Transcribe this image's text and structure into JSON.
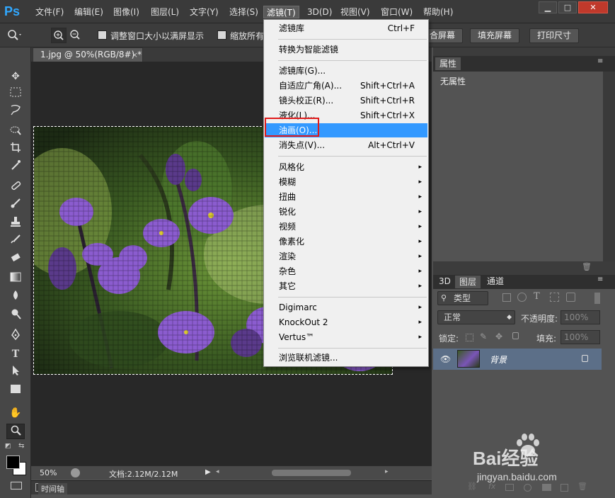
{
  "app": {
    "logo": "Ps"
  },
  "menubar": {
    "items": [
      {
        "label": "文件(F)"
      },
      {
        "label": "编辑(E)"
      },
      {
        "label": "图像(I)"
      },
      {
        "label": "图层(L)"
      },
      {
        "label": "文字(Y)"
      },
      {
        "label": "选择(S)"
      },
      {
        "label": "滤镜(T)"
      },
      {
        "label": "3D(D)"
      },
      {
        "label": "视图(V)"
      },
      {
        "label": "窗口(W)"
      },
      {
        "label": "帮助(H)"
      }
    ],
    "window_controls": {
      "minimize": "▁",
      "maximize": "□",
      "close": "✕"
    }
  },
  "optionsbar": {
    "checkbox1_label": "调整窗口大小以满屏显示",
    "checkbox2_label": "缩放所有",
    "fit_screen": "合屏幕",
    "fill_screen": "填充屏幕",
    "print_size": "打印尺寸"
  },
  "document": {
    "tab_title": "1.jpg @ 50%(RGB/8#) *",
    "tab_close": "×"
  },
  "status": {
    "zoom": "50%",
    "doc_size": "文档:2.12M/2.12M"
  },
  "timeline": {
    "label": "时间轴"
  },
  "properties_panel": {
    "tab": "属性",
    "content": "无属性"
  },
  "layers_panel": {
    "tabs": [
      "3D",
      "图层",
      "通道"
    ],
    "filter_kind": "类型",
    "blend_mode": "正常",
    "opacity_label": "不透明度:",
    "opacity_value": "100%",
    "lock_label": "锁定:",
    "fill_label": "填充:",
    "fill_value": "100%",
    "layer_name": "背景"
  },
  "filter_menu": {
    "items": [
      {
        "label": "滤镜库",
        "shortcut": "Ctrl+F"
      },
      {
        "label": "转换为智能滤镜"
      },
      {
        "label": "滤镜库(G)..."
      },
      {
        "label": "自适应广角(A)...",
        "shortcut": "Shift+Ctrl+A"
      },
      {
        "label": "镜头校正(R)...",
        "shortcut": "Shift+Ctrl+R"
      },
      {
        "label": "液化(L)...",
        "shortcut": "Shift+Ctrl+X"
      },
      {
        "label": "油画(O)..."
      },
      {
        "label": "消失点(V)...",
        "shortcut": "Alt+Ctrl+V"
      },
      {
        "label": "风格化"
      },
      {
        "label": "模糊"
      },
      {
        "label": "扭曲"
      },
      {
        "label": "锐化"
      },
      {
        "label": "视频"
      },
      {
        "label": "像素化"
      },
      {
        "label": "渲染"
      },
      {
        "label": "杂色"
      },
      {
        "label": "其它"
      },
      {
        "label": "Digimarc"
      },
      {
        "label": "KnockOut 2"
      },
      {
        "label": "Vertus™"
      },
      {
        "label": "浏览联机滤镜..."
      }
    ],
    "submenu_arrow": "▸"
  },
  "watermark": {
    "brand": "Bai经验",
    "url": "jingyan.baidu.com"
  },
  "colors": {
    "highlight": "#3399ff",
    "annotation": "#e01a1a",
    "menubar": "#3a3a3a"
  }
}
